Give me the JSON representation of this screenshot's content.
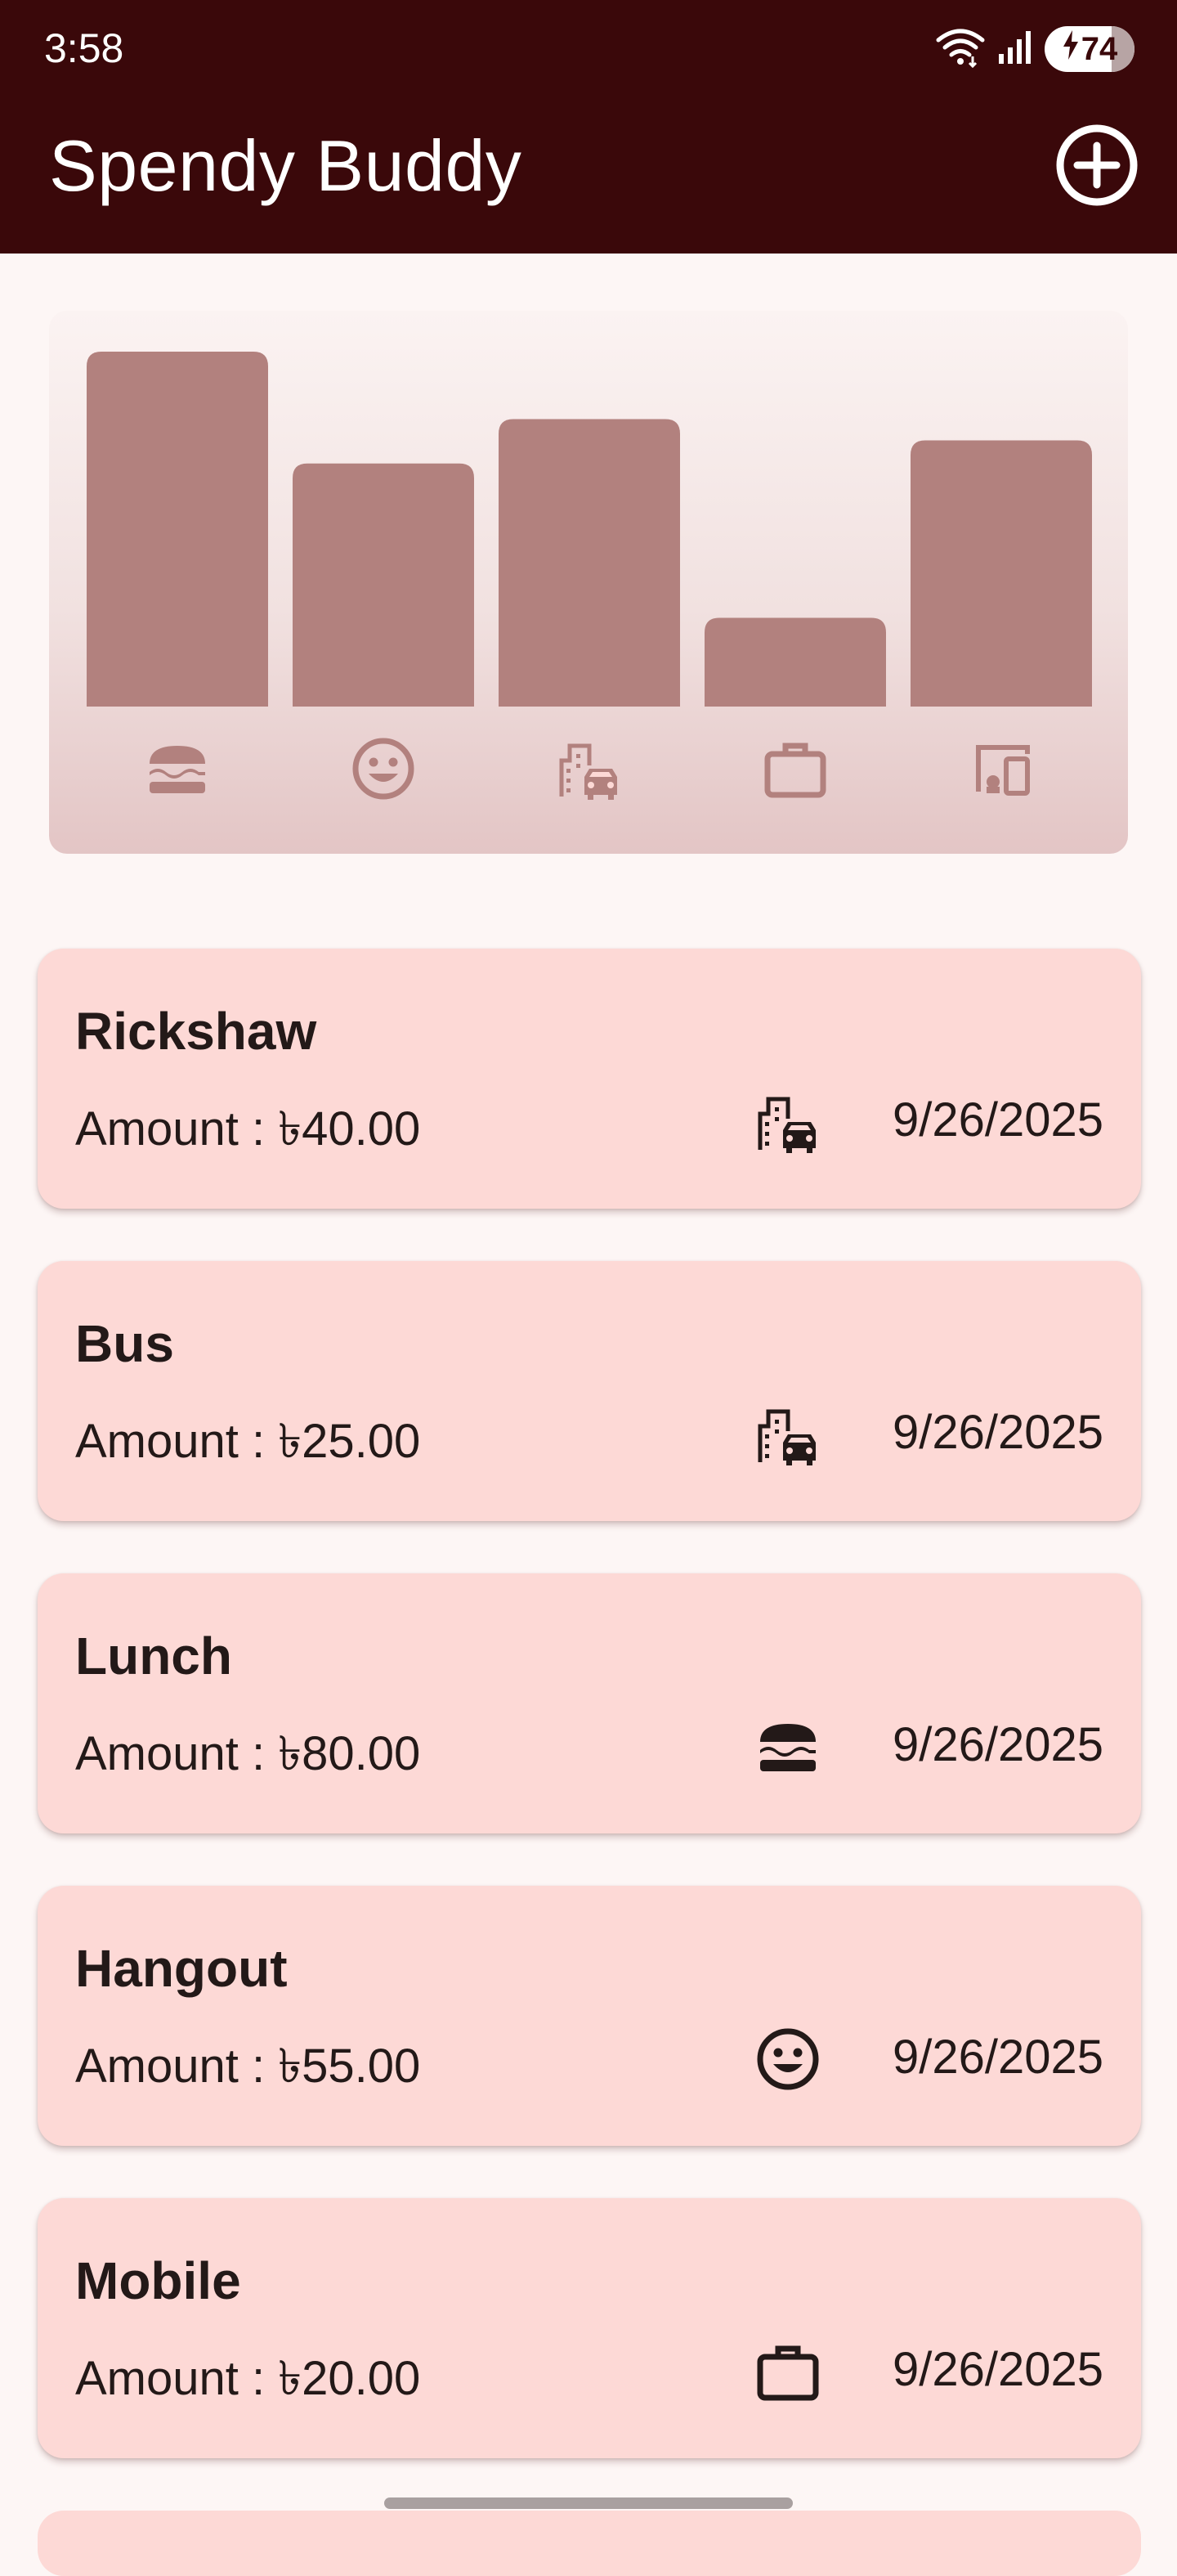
{
  "status_bar": {
    "time": "3:58",
    "battery": "74"
  },
  "app": {
    "title": "Spendy Buddy"
  },
  "colors": {
    "appbar": "#3a080a",
    "bar": "#b2817e",
    "card": "#fdd9d6",
    "icon_dark": "#231918"
  },
  "chart_data": {
    "type": "bar",
    "categories": [
      "food",
      "leisure",
      "travel",
      "work",
      "mobile"
    ],
    "category_icons": [
      "burger-icon",
      "smiley-icon",
      "travel-icon",
      "briefcase-icon",
      "devices-icon"
    ],
    "values": [
      1.0,
      0.685,
      0.81,
      0.25,
      0.75
    ],
    "ylim": [
      0,
      1
    ],
    "grid": false,
    "legend": false
  },
  "expenses": [
    {
      "title": "Rickshaw",
      "amount": "Amount : ৳40.00",
      "category": "travel-icon",
      "date": "9/26/2025"
    },
    {
      "title": "Bus",
      "amount": "Amount : ৳25.00",
      "category": "travel-icon",
      "date": "9/26/2025"
    },
    {
      "title": "Lunch",
      "amount": "Amount : ৳80.00",
      "category": "burger-icon",
      "date": "9/26/2025"
    },
    {
      "title": "Hangout",
      "amount": "Amount : ৳55.00",
      "category": "smiley-icon",
      "date": "9/26/2025"
    },
    {
      "title": "Mobile",
      "amount": "Amount : ৳20.00",
      "category": "briefcase-icon",
      "date": "9/26/2025"
    }
  ]
}
